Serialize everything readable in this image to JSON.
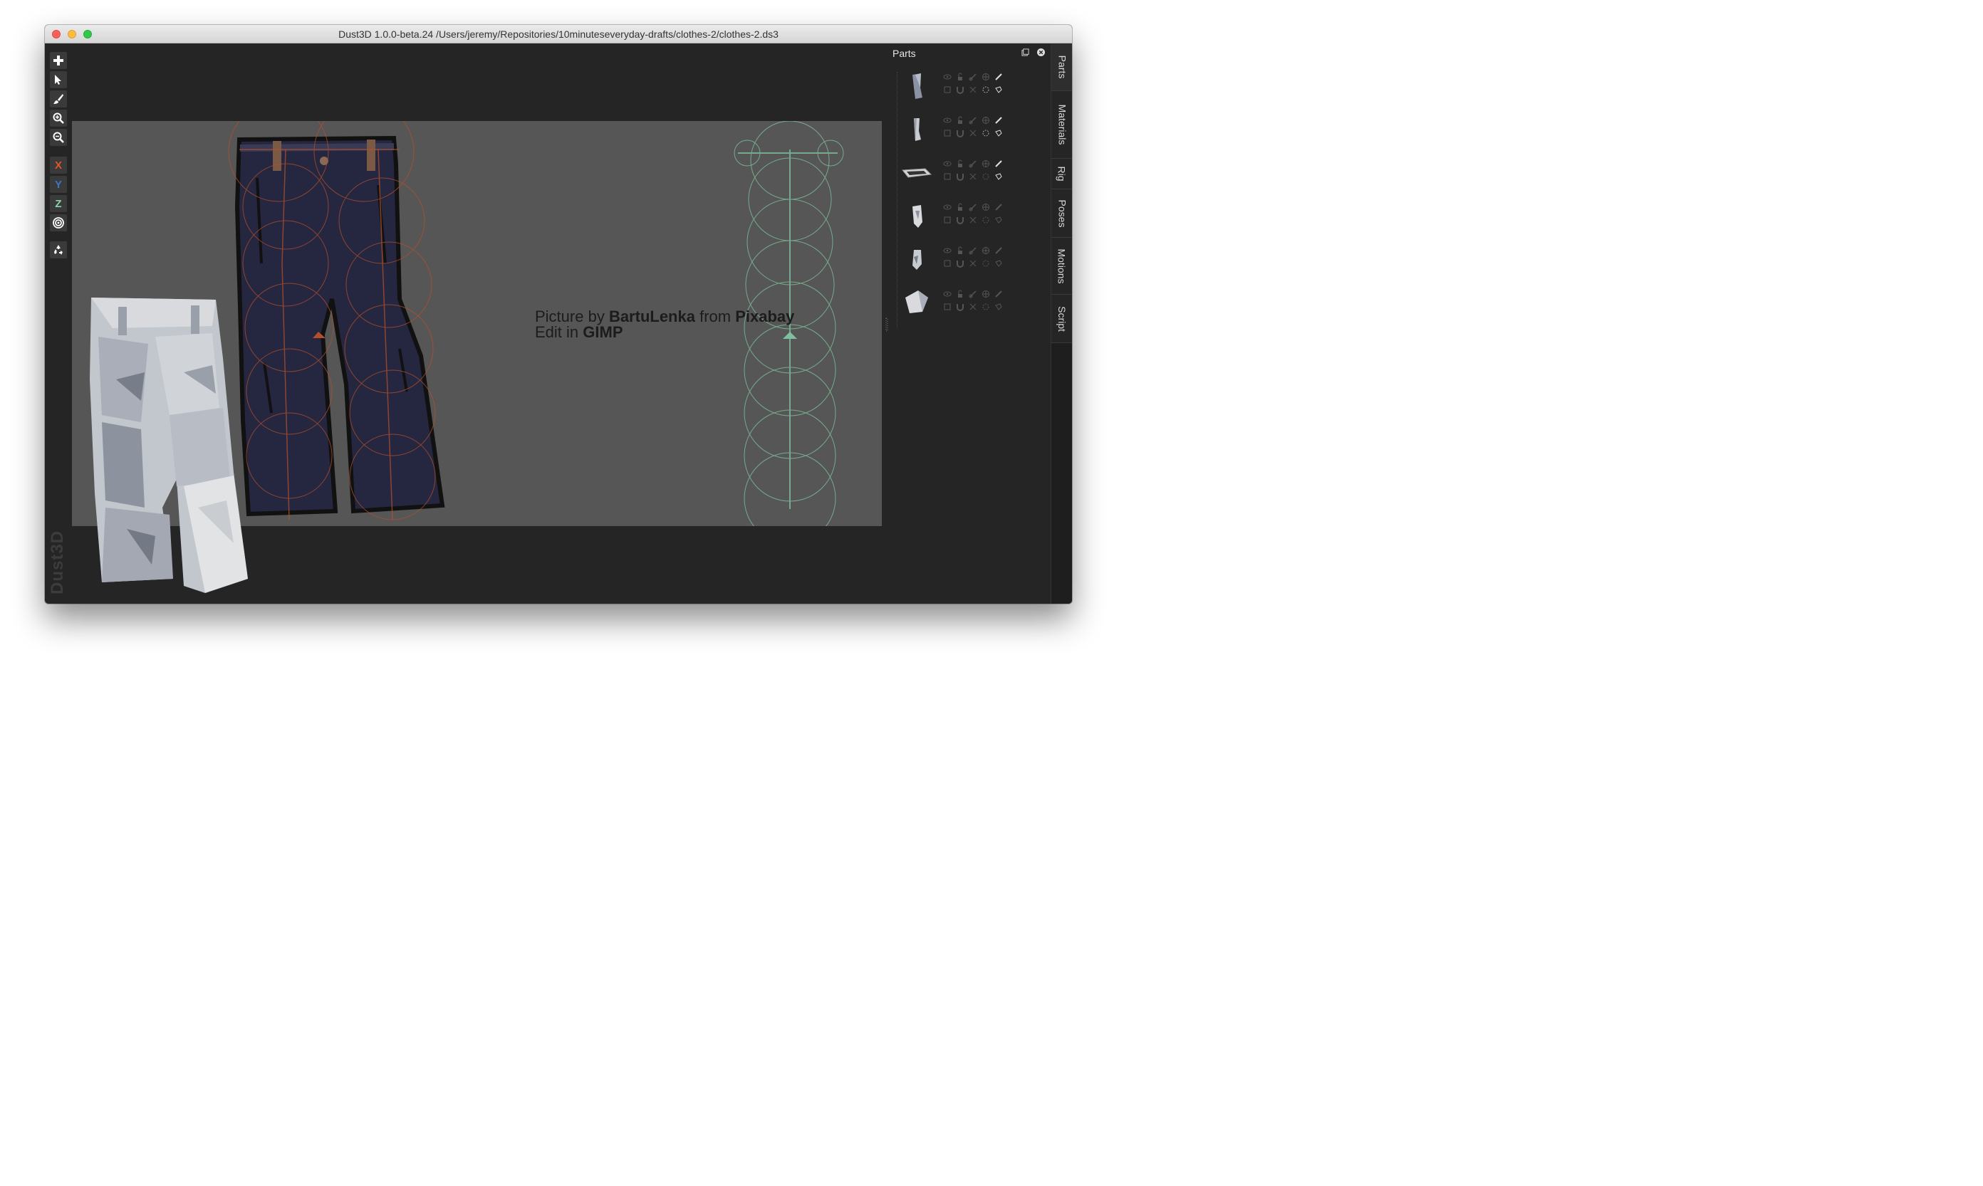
{
  "window": {
    "title": "Dust3D 1.0.0-beta.24 /Users/jeremy/Repositories/10minuteseveryday-drafts/clothes-2/clothes-2.ds3"
  },
  "toolbar": {
    "x_label": "X",
    "y_label": "Y",
    "z_label": "Z",
    "x_color": "#e0562b",
    "y_color": "#3d76c6",
    "z_color": "#8ad2a8"
  },
  "canvas": {
    "credit_line1_prefix": "Picture by ",
    "credit_author": "BartuLenka",
    "credit_line1_mid": " from ",
    "credit_site": "Pixabay",
    "credit_line2_prefix": "Edit in ",
    "credit_tool": "GIMP"
  },
  "watermark": "Dust3D",
  "parts_panel": {
    "title": "Parts",
    "items": [
      {
        "id": "part-1",
        "thumb": "leg-upper"
      },
      {
        "id": "part-2",
        "thumb": "leg-lower"
      },
      {
        "id": "part-3",
        "thumb": "waistband"
      },
      {
        "id": "part-4",
        "thumb": "leg-cuff"
      },
      {
        "id": "part-5",
        "thumb": "leg-cuff-2"
      },
      {
        "id": "part-6",
        "thumb": "block"
      }
    ]
  },
  "side_tabs": [
    "Parts",
    "Materials",
    "Rig",
    "Poses",
    "Motions",
    "Script"
  ]
}
